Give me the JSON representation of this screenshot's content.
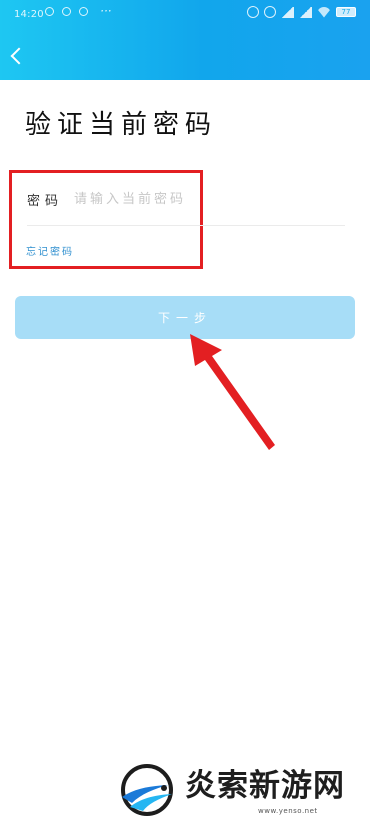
{
  "status_bar": {
    "time": "14:20",
    "dots": "···",
    "battery": "77"
  },
  "header": {
    "back_icon": "chevron-left-icon",
    "background_color": "#1ab1ee"
  },
  "page": {
    "title": "验证当前密码"
  },
  "form": {
    "password_label": "密码",
    "password_placeholder": "请输入当前密码",
    "password_value": "",
    "forgot_password": "忘记密码"
  },
  "actions": {
    "next_label": "下一步"
  },
  "annotation": {
    "highlight_color": "#e31f22",
    "arrow_color": "#e31f22"
  },
  "watermark": {
    "text": "炎索新游网",
    "url": "www.yenso.net"
  },
  "colors": {
    "accent": "#1ab1ee",
    "button_disabled": "#a7ddf7",
    "link": "#2f8fcf"
  }
}
